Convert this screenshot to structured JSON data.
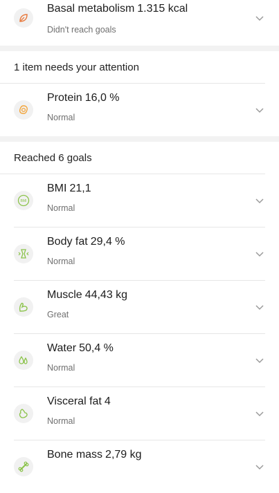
{
  "top_item": {
    "metric": "Basal metabolism",
    "value": "1.315 kcal",
    "status": "Didn't reach goals",
    "icon": "leaf-icon",
    "icon_color": "#E87A3E"
  },
  "attention_section": {
    "title": "1 item needs your attention",
    "items": [
      {
        "metric": "Protein",
        "value": "16,0 %",
        "status": "Normal",
        "icon": "egg-icon",
        "icon_color": "#F2A43A"
      }
    ]
  },
  "goals_section": {
    "title": "Reached 6 goals",
    "items": [
      {
        "metric": "BMI",
        "value": "21,1",
        "status": "Normal",
        "icon": "bmi-icon",
        "icon_label": "BMI",
        "icon_color": "#8BC34A"
      },
      {
        "metric": "Body fat",
        "value": "29,4 %",
        "status": "Normal",
        "icon": "body-fat-icon",
        "icon_color": "#8BC34A"
      },
      {
        "metric": "Muscle",
        "value": "44,43 kg",
        "status": "Great",
        "icon": "muscle-arm-icon",
        "icon_color": "#8BC34A"
      },
      {
        "metric": "Water",
        "value": "50,4 %",
        "status": "Normal",
        "icon": "water-drops-icon",
        "icon_color": "#8BC34A"
      },
      {
        "metric": "Visceral fat",
        "value": "4",
        "status": "Normal",
        "icon": "visceral-fat-icon",
        "icon_color": "#8BC34A"
      },
      {
        "metric": "Bone mass",
        "value": "2,79 kg",
        "status": "",
        "icon": "bone-icon",
        "icon_color": "#8BC34A"
      }
    ]
  }
}
